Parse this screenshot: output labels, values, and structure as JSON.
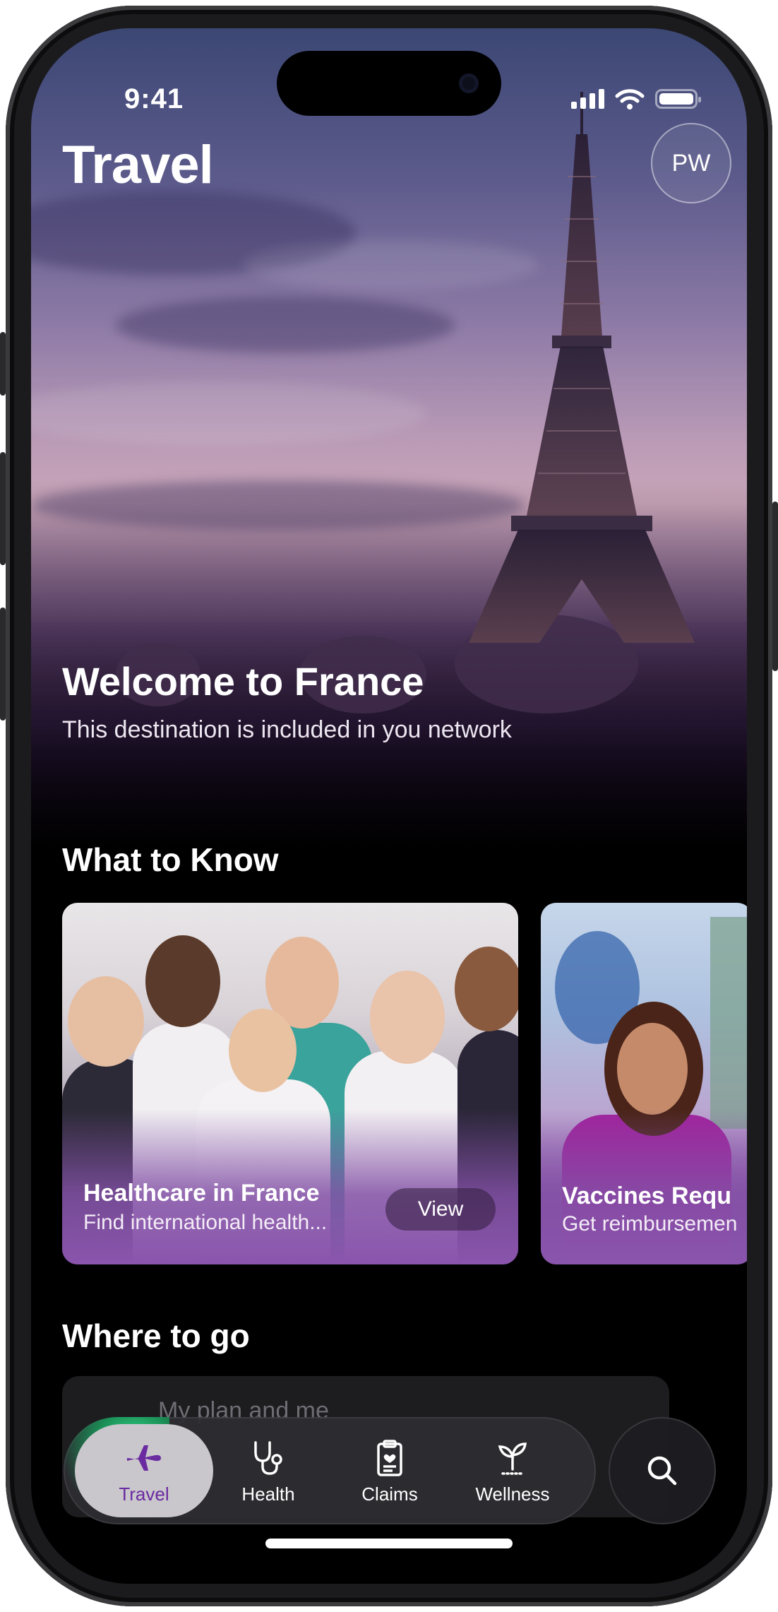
{
  "status_bar": {
    "time": "9:41"
  },
  "header": {
    "title": "Travel",
    "avatar_initials": "PW"
  },
  "hero": {
    "headline": "Welcome to France",
    "subtitle": "This destination is included in you network"
  },
  "what_to_know": {
    "section_title": "What to Know",
    "cards": [
      {
        "title": "Healthcare in France",
        "subtitle": "Find international health...",
        "button_label": "View"
      },
      {
        "title": "Vaccines Requ",
        "subtitle": "Get reimbursemen"
      }
    ]
  },
  "where_to_go": {
    "section_title": "Where to go",
    "plan_card_text": "My plan and me"
  },
  "bottom_nav": {
    "items": [
      {
        "label": "Travel",
        "icon": "airplane-icon",
        "active": true
      },
      {
        "label": "Health",
        "icon": "stethoscope-icon",
        "active": false
      },
      {
        "label": "Claims",
        "icon": "clipboard-icon",
        "active": false
      },
      {
        "label": "Wellness",
        "icon": "sprout-icon",
        "active": false
      }
    ],
    "search_icon": "search-icon"
  },
  "colors": {
    "accent": "#6a2aa0",
    "card_gradient": "#8a55ad",
    "background": "#000000"
  }
}
